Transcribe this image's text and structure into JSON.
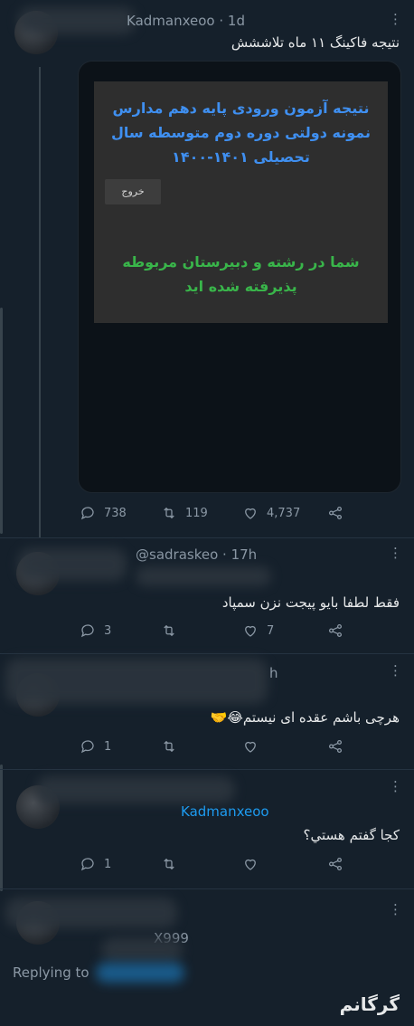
{
  "colors": {
    "background": "#15202b",
    "muted": "#8b98a5",
    "link": "#1d9bf0",
    "card_title": "#3f8ff0",
    "card_success": "#39b54a"
  },
  "tweet1": {
    "handle_visible": "Kadmanxeoo · 1d",
    "text": "نتیجه فاکینگ ۱۱ ماه تلاششش",
    "card": {
      "title": "نتیجه آزمون ورودی پایه دهم مدارس نمونه دولتی دوره دوم متوسطه سال تحصیلی ۱۴۰۱-۱۴۰۰",
      "exit_button": "خروج",
      "message": "شما در رشته و دبیرستان مربوطه پذیرفته شده اید"
    },
    "reply_count": "738",
    "retweet_count": "119",
    "like_count": "4,737"
  },
  "reply1": {
    "handle_visible": "@sadraskeo · 17h",
    "text": "فقط لطفا بایو پیجت نزن سمپاد",
    "reply_count": "3",
    "retweet_count": "",
    "like_count": "7"
  },
  "reply2": {
    "handle_visible": "h",
    "text": "هرچی باشم عقده ای نیستم😂🤝",
    "reply_count": "1",
    "retweet_count": "",
    "like_count": ""
  },
  "reply3": {
    "handle_visible": "Kadmanxeoo",
    "text": "کجا گفتم هستي؟",
    "reply_count": "1",
    "retweet_count": "",
    "like_count": ""
  },
  "reply4": {
    "handle_visible": "X999",
    "replying_label": "Replying to",
    "text": "گرگانم"
  },
  "icons": [
    "more-icon",
    "reply-icon",
    "retweet-icon",
    "like-icon",
    "share-icon"
  ]
}
